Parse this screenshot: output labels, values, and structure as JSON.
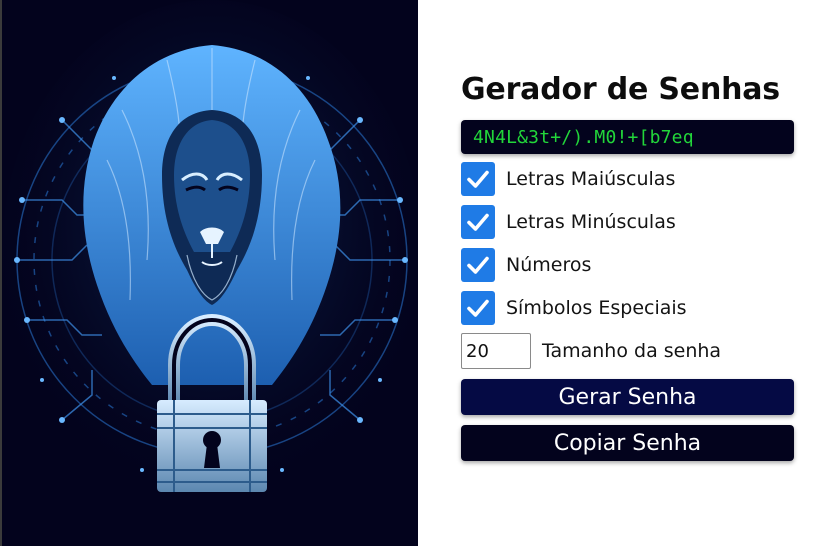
{
  "hero": {
    "image": "lion-with-padlock-circuit-illustration",
    "colors": {
      "background": "#03031d",
      "accent": "#4aa3ff",
      "highlight": "#cfe8ff"
    }
  },
  "generator": {
    "title": "Gerador de Senhas",
    "password": "4N4L&3t+/).M0!+[b7eq",
    "options": [
      {
        "label": "Letras Maiúsculas",
        "checked": true
      },
      {
        "label": "Letras Minúsculas",
        "checked": true
      },
      {
        "label": "Números",
        "checked": true
      },
      {
        "label": "Símbolos Especiais",
        "checked": true
      }
    ],
    "length": {
      "value": "20",
      "label": "Tamanho da senha"
    },
    "buttons": {
      "generate": "Gerar Senha",
      "copy": "Copiar Senha"
    }
  },
  "colors": {
    "password_text": "#22d63a",
    "checkbox": "#1f7be6",
    "button_generate": "#050a44",
    "button_copy": "#03031d"
  }
}
